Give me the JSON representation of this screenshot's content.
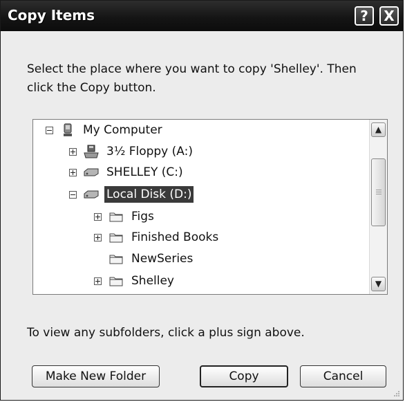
{
  "window": {
    "title": "Copy Items",
    "help_glyph": "?",
    "close_glyph": "X"
  },
  "instruction": "Select the place where you want to copy 'Shelley'. Then click the Copy button.",
  "tree": {
    "items": [
      {
        "label": "My Computer",
        "expander": "minus",
        "icon": "computer-icon",
        "selected": false
      },
      {
        "label": "3½ Floppy (A:)",
        "expander": "plus",
        "icon": "floppy-drive-icon",
        "selected": false
      },
      {
        "label": "SHELLEY (C:)",
        "expander": "plus",
        "icon": "hard-drive-icon",
        "selected": false
      },
      {
        "label": "Local Disk (D:)",
        "expander": "minus",
        "icon": "hard-drive-icon",
        "selected": true
      },
      {
        "label": "Figs",
        "expander": "plus",
        "icon": "folder-icon",
        "selected": false
      },
      {
        "label": "Finished Books",
        "expander": "plus",
        "icon": "folder-icon",
        "selected": false
      },
      {
        "label": "NewSeries",
        "expander": "none",
        "icon": "folder-icon",
        "selected": false
      },
      {
        "label": "Shelley",
        "expander": "plus",
        "icon": "folder-icon",
        "selected": false
      }
    ]
  },
  "hint": "To view any subfolders, click a plus sign above.",
  "buttons": {
    "make_new_folder": "Make New Folder",
    "copy": "Copy",
    "cancel": "Cancel"
  }
}
